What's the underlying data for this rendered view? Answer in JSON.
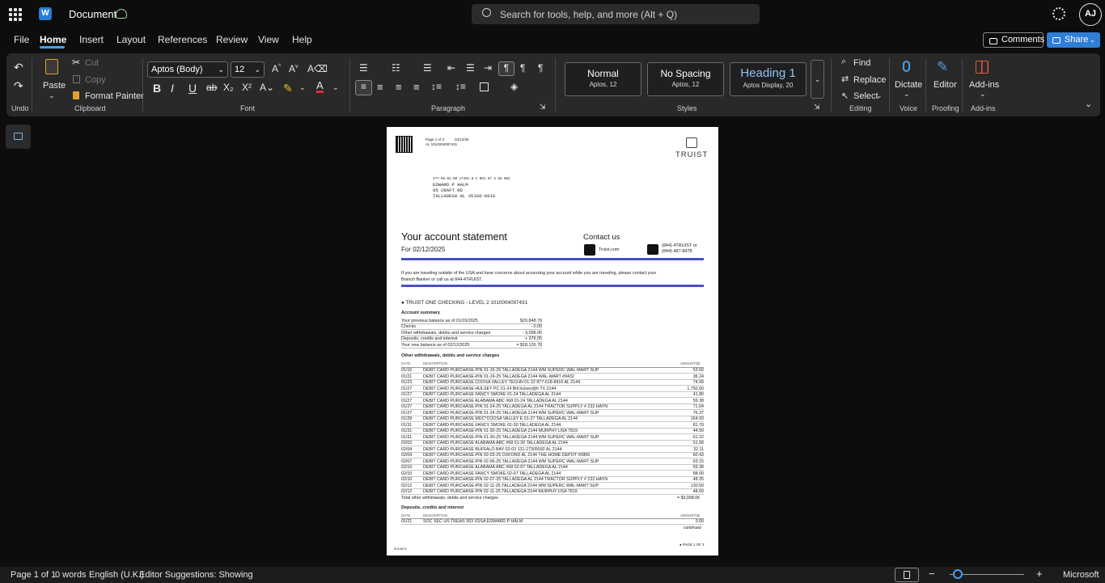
{
  "app": {
    "title": "Document",
    "search_placeholder": "Search for tools, help, and more (Alt + Q)",
    "user_initials": "AJ"
  },
  "menu": [
    "File",
    "Home",
    "Insert",
    "Layout",
    "References",
    "Review",
    "View",
    "Help"
  ],
  "actions": {
    "comments": "Comments",
    "share": "Share"
  },
  "ribbon": {
    "undo_label": "Undo",
    "clipboard": {
      "paste": "Paste",
      "cut": "Cut",
      "copy": "Copy",
      "format_painter": "Format Painter",
      "label": "Clipboard"
    },
    "font": {
      "family": "Aptos (Body)",
      "size": "12",
      "label": "Font"
    },
    "paragraph": {
      "label": "Paragraph"
    },
    "styles": {
      "items": [
        {
          "name": "Normal",
          "sub": "Aptos, 12"
        },
        {
          "name": "No Spacing",
          "sub": "Aptos, 12"
        },
        {
          "name": "Heading 1",
          "sub": "Aptos Display, 20"
        }
      ],
      "label": "Styles"
    },
    "editing": {
      "find": "Find",
      "replace": "Replace",
      "select": "Select",
      "label": "Editing"
    },
    "voice": {
      "dictate": "Dictate",
      "label": "Voice"
    },
    "proofing": {
      "editor": "Editor",
      "label": "Proofing"
    },
    "addins": {
      "addins": "Add-ins",
      "label": "Add-ins"
    }
  },
  "status": {
    "page": "Page 1 of 1",
    "words": "0 words",
    "language": "English (U.K.)",
    "suggestions": "Editor Suggestions: Showing",
    "brand": "Microsoft"
  },
  "statement": {
    "page_header": "Page 1 of 3",
    "header_date": "02/12/25",
    "header_account": "AL        1010004097431",
    "bank": "TRUIST",
    "address": [
      "277-05-01-00 17491 0 C 001 87 S 66 002",
      "EDWARD  P  HALM",
      "95  CRAFT  RD",
      "TALLADEGA  AL    35160-6616"
    ],
    "title": "Your account statement",
    "for_date": "For 02/12/2025",
    "contact_title": "Contact us",
    "website": "Truist.com",
    "phone": [
      "(844) 4TRUIST or",
      "(844) 487-8478"
    ],
    "travel_notice": [
      "If you are traveling outside of the USA and have concerns about accessing your account while you are traveling, please contact your",
      "Branch Banker or call us at 844-4TRUIST."
    ],
    "account_line": "TRUIST ONE CHECKING - LEVEL 2 1010004097431",
    "summary_title": "Account summary",
    "summary": [
      [
        "Your previous balance as of 01/15/2025",
        "$20,848.79"
      ],
      [
        "Checks",
        "- 0.00"
      ],
      [
        "Other withdrawals, debits and service charges",
        "- 3,098.06"
      ],
      [
        "Deposits, credits and interest",
        "+ 376.05"
      ],
      [
        "Your new balance as of 02/12/2025",
        "= $18,126.78"
      ]
    ],
    "withdrawals_title": "Other withdrawals, debits and service charges",
    "col_date": "DATE",
    "col_desc": "DESCRIPTION",
    "col_amount": "AMOUNT($)",
    "withdrawals": [
      [
        "01/16",
        "DEBIT CARD PURCHASE-PIN 01-15-25 TALLADEGA        2144 WM SUPERC WAL-MART SUP",
        "53.60"
      ],
      [
        "01/21",
        "DEBIT CARD PURCHASE-PIN 01-19-25 TALLADEGA        2144 WAL-MART #0432",
        "36.24"
      ],
      [
        "01/23",
        "DEBIT CARD PURCHASE COOSA VALLEY TECHN 01-22 877-618-8916   AL  2144",
        "74.99"
      ],
      [
        "01/27",
        "DEBIT CARD PURCHASE HULSEY PC 01-24 Bill.hulsey@h   TX  2144",
        "1,750.00"
      ],
      [
        "01/27",
        "DEBIT CARD PURCHASE FANCY SMOKE 01-24 TALLADEGA     AL  2144",
        "41.80"
      ],
      [
        "01/27",
        "DEBIT CARD PURCHASE ALABAMA ABC #68 01-24 TALLADEGA      AL  2144",
        "59.38"
      ],
      [
        "01/27",
        "DEBIT CARD PURCHASE-PIN 01-24-25 TALLADEGA    AL 2144 TRACTOR SUPPLY # 232 HAYN",
        "71.64"
      ],
      [
        "01/27",
        "DEBIT CARD PURCHASE-PIN 01-24-25 TALLADEGA        2144 WM SUPERC WAL-MART SUP",
        "76.37"
      ],
      [
        "01/28",
        "DEBIT CARD PURCHASE MDC*COOSA VALLEY E 01-27 TALLADEGA      AL  2144",
        "164.93"
      ],
      [
        "01/31",
        "DEBIT CARD PURCHASE FANCY SMOKE 01-30 TALLADEGA     AL  2144",
        "81.70"
      ],
      [
        "01/31",
        "DEBIT CARD PURCHASE-PIN 01-30-25 TALLADEGA        2144 MURPHY USA 7819",
        "44.50"
      ],
      [
        "01/31",
        "DEBIT CARD PURCHASE-PIN 01-30-25 TALLADEGA        2144 WM SUPERC WAL-MART SUP",
        "61.22"
      ],
      [
        "02/03",
        "DEBIT CARD PURCHASE ALABAMA ABC #68 01-30 TALLADEGA      AL  2144",
        "51.68"
      ],
      [
        "02/04",
        "DEBIT CARD PURCHASE BUFFALO BAY 02-03 131-27305592    AL  2144",
        "32.11"
      ],
      [
        "02/04",
        "DEBIT CARD PURCHASE-PIN 02-03-25 OXFORD       AL 2144 THE HOME DEPOT #0866",
        "60.43"
      ],
      [
        "02/07",
        "DEBIT CARD PURCHASE-PIN 02-06-25 TALLADEGA        2144 WM SUPERC WAL-MART SUP",
        "63.15"
      ],
      [
        "02/10",
        "DEBIT CARD PURCHASE ALABAMA ABC #68 02-07 TALLADEGA      AL  2144",
        "59.38"
      ],
      [
        "02/10",
        "DEBIT CARD PURCHASE FANCY SMOKE 02-07 TALLADEGA     AL  2144",
        "88.00"
      ],
      [
        "02/10",
        "DEBIT CARD PURCHASE-PIN 02-07-25 TALLADEGA    AL 2144 TRACTOR SUPPLY # 232 HAYN",
        "48.35"
      ],
      [
        "02/12",
        "DEBIT CARD PURCHASE-PIN 02-11-25 TALLADEGA        2144 WM SUPERC WAL-MART SUP",
        "130.59"
      ],
      [
        "02/12",
        "DEBIT CARD PURCHASE-PIN 02-11-25 TALLADEGA        2144 MURPHY USA 7819",
        "48.00"
      ]
    ],
    "withdrawals_total_label": "Total other withdrawals, debits and service charges",
    "withdrawals_total": "= $3,098.06",
    "deposits_title": "Deposits, credits and interest",
    "deposits": [
      [
        "01/21",
        "SOC SEC    US TREAS 303 XSSA EDWARD P HALM",
        "0.00"
      ]
    ],
    "continued": "continued",
    "footer_code": "0014679",
    "footer_page": "PAGE 1 OF 3"
  }
}
